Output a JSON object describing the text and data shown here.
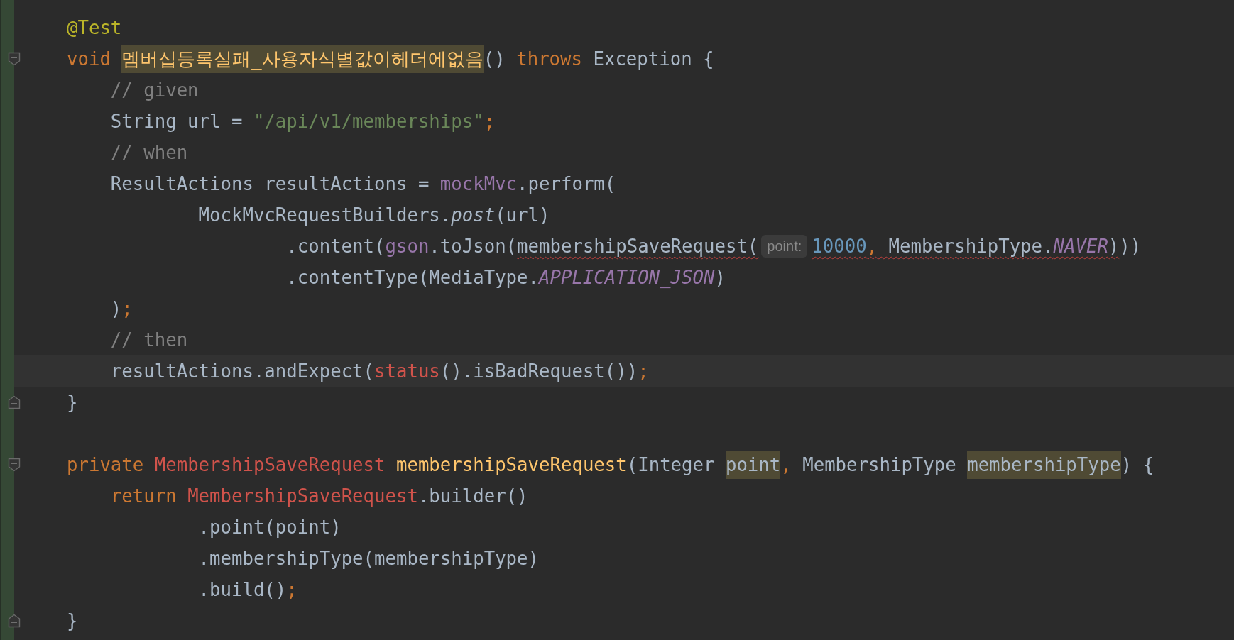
{
  "editor": {
    "lines": [
      {
        "tokens": [
          {
            "text": "@Test",
            "kind": "annotation"
          }
        ]
      },
      {
        "kind": "fold-start",
        "tokens": [
          {
            "text": "void ",
            "kind": "keyword"
          },
          {
            "text": "멤버십등록실패_사용자식별값이헤더에없음",
            "kind": "method-decl",
            "highlighted": true
          },
          {
            "text": "() ",
            "kind": "plain"
          },
          {
            "text": "throws",
            "kind": "keyword"
          },
          {
            "text": " Exception {",
            "kind": "plain"
          }
        ],
        "children": [
          {
            "tokens": [
              {
                "text": "// given",
                "kind": "comment"
              }
            ]
          },
          {
            "tokens": [
              {
                "text": "String url = ",
                "kind": "plain"
              },
              {
                "text": "\"/api/v1/memberships\"",
                "kind": "string"
              },
              {
                "text": ";",
                "kind": "keyword"
              }
            ]
          },
          {
            "tokens": [
              {
                "text": "// when",
                "kind": "comment"
              }
            ]
          },
          {
            "tokens": [
              {
                "text": "ResultActions resultActions = ",
                "kind": "plain"
              },
              {
                "text": "mockMvc",
                "kind": "field"
              },
              {
                "text": ".perform(",
                "kind": "plain"
              }
            ],
            "children": [
              {
                "tokens": [
                  {
                    "text": "MockMvcRequestBuilders.",
                    "kind": "plain"
                  },
                  {
                    "text": "post",
                    "kind": "static-method"
                  },
                  {
                    "text": "(url)",
                    "kind": "plain"
                  }
                ],
                "children": [
                  {
                    "tokens": [
                      {
                        "text": ".content(",
                        "kind": "plain"
                      },
                      {
                        "text": "gson",
                        "kind": "field"
                      },
                      {
                        "text": ".toJson(",
                        "kind": "plain"
                      },
                      {
                        "text": "membershipSaveRequest(",
                        "kind": "plain",
                        "error": true
                      },
                      {
                        "text": "point:",
                        "kind": "hint"
                      },
                      {
                        "text": "10000",
                        "kind": "number",
                        "error": true
                      },
                      {
                        "text": ",",
                        "kind": "keyword",
                        "error": true
                      },
                      {
                        "text": " MembershipType.",
                        "kind": "plain",
                        "error": true
                      },
                      {
                        "text": "NAVER",
                        "kind": "static-field",
                        "error": true
                      },
                      {
                        "text": ")",
                        "kind": "plain",
                        "error": true
                      },
                      {
                        "text": "))",
                        "kind": "plain"
                      }
                    ]
                  },
                  {
                    "tokens": [
                      {
                        "text": ".contentType(MediaType.",
                        "kind": "plain"
                      },
                      {
                        "text": "APPLICATION_JSON",
                        "kind": "static-field"
                      },
                      {
                        "text": ")",
                        "kind": "plain"
                      }
                    ]
                  }
                ]
              }
            ]
          },
          {
            "tokens": [
              {
                "text": ")",
                "kind": "plain"
              },
              {
                "text": ";",
                "kind": "keyword"
              }
            ]
          },
          {
            "tokens": [
              {
                "text": "// then",
                "kind": "comment"
              }
            ]
          },
          {
            "current": true,
            "tokens": [
              {
                "text": "resultActions.andExpect(",
                "kind": "plain"
              },
              {
                "text": "status",
                "kind": "unresolved"
              },
              {
                "text": "().isBadRequest())",
                "kind": "plain"
              },
              {
                "text": ";",
                "kind": "keyword"
              }
            ]
          }
        ]
      },
      {
        "kind": "fold-end",
        "tokens": [
          {
            "text": "}",
            "kind": "plain"
          }
        ]
      },
      {
        "kind": "blank"
      },
      {
        "kind": "fold-start",
        "tokens": [
          {
            "text": "private ",
            "kind": "keyword"
          },
          {
            "text": "MembershipSaveRequest ",
            "kind": "unresolved"
          },
          {
            "text": "membershipSaveRequest",
            "kind": "method-decl"
          },
          {
            "text": "(Integer ",
            "kind": "plain"
          },
          {
            "text": "point",
            "kind": "plain",
            "highlighted": true
          },
          {
            "text": ",",
            "kind": "keyword"
          },
          {
            "text": " MembershipType ",
            "kind": "plain"
          },
          {
            "text": "membershipType",
            "kind": "plain",
            "highlighted": true
          },
          {
            "text": ") {",
            "kind": "plain"
          }
        ],
        "children": [
          {
            "tokens": [
              {
                "text": "return ",
                "kind": "keyword"
              },
              {
                "text": "MembershipSaveRequest",
                "kind": "unresolved"
              },
              {
                "text": ".builder()",
                "kind": "plain"
              }
            ],
            "children": [
              {
                "tokens": [
                  {
                    "text": ".point(point)",
                    "kind": "plain"
                  }
                ]
              },
              {
                "tokens": [
                  {
                    "text": ".membershipType(membershipType)",
                    "kind": "plain"
                  }
                ]
              },
              {
                "tokens": [
                  {
                    "text": ".build()",
                    "kind": "plain"
                  },
                  {
                    "text": ";",
                    "kind": "keyword"
                  }
                ]
              }
            ]
          }
        ]
      },
      {
        "kind": "fold-end",
        "tokens": [
          {
            "text": "}",
            "kind": "plain"
          }
        ]
      }
    ]
  }
}
